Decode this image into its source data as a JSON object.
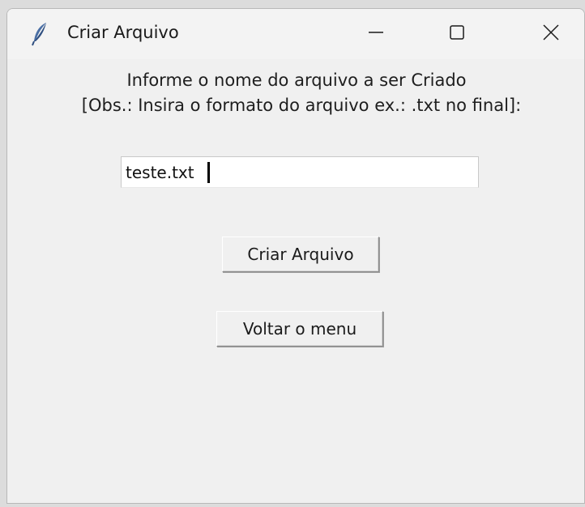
{
  "window": {
    "title": "Criar Arquivo",
    "icon": "feather-icon"
  },
  "controls": {
    "minimize_icon": "minimize-icon",
    "maximize_icon": "maximize-icon",
    "close_icon": "close-icon"
  },
  "form": {
    "prompt_line1": "Informe o nome do arquivo a ser Criado",
    "prompt_line2": "[Obs.: Insira o formato do arquivo ex.: .txt no final]:",
    "filename_value": "teste.txt",
    "create_button": "Criar Arquivo",
    "back_button": "Voltar o menu"
  },
  "colors": {
    "window_bg": "#f0f0f0",
    "icon_color": "#4a6fa5"
  }
}
